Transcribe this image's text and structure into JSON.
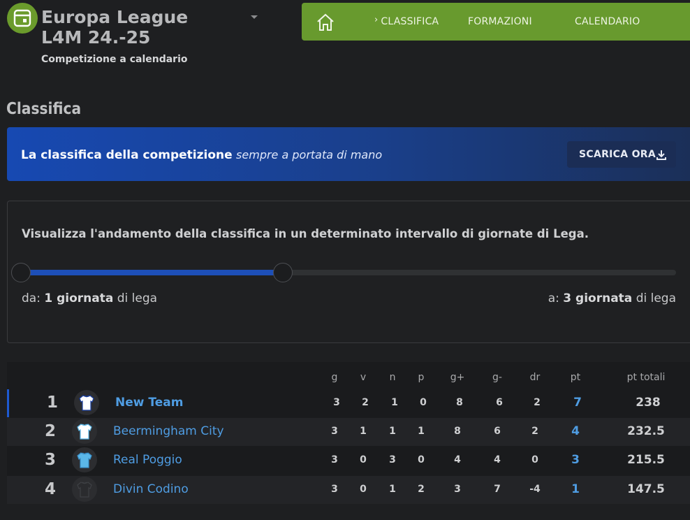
{
  "league": {
    "title": "Europa League L4M 24.-25",
    "subtitle": "Competizione a calendario",
    "logo_icon": "calendar-icon"
  },
  "nav": {
    "home_icon": "home-icon",
    "items": [
      {
        "label": "CLASSIFICA",
        "active": true
      },
      {
        "label": "FORMAZIONI",
        "active": false
      },
      {
        "label": "CALENDARIO",
        "active": false
      }
    ],
    "active_chevron": "›"
  },
  "page": {
    "title": "Classifica"
  },
  "promo": {
    "text_strong": "La classifica della competizione",
    "text_em": "sempre a portata di mano",
    "button_label": "SCARICA ORA",
    "button_icon": "download-icon"
  },
  "range": {
    "description": "Visualizza l'andamento della classifica in un determinato intervallo di giornate di Lega.",
    "from_prefix": "da:",
    "from_value": "1 giornata",
    "from_suffix": "di lega",
    "to_prefix": "a:",
    "to_value": "3 giornata",
    "to_suffix": "di lega",
    "slider_start_fraction": 0.0,
    "slider_end_fraction": 0.4
  },
  "standings": {
    "columns": [
      "g",
      "v",
      "n",
      "p",
      "g+",
      "g-",
      "dr",
      "pt",
      "pt totali"
    ],
    "rows": [
      {
        "rank": "1",
        "team": "New Team",
        "g": "3",
        "v": "2",
        "n": "1",
        "p": "0",
        "gf": "8",
        "ga": "6",
        "dr": "2",
        "pt": "7",
        "pt_totali": "238",
        "shirt_body": "#ffffff",
        "shirt_accent": "#1a3fa0"
      },
      {
        "rank": "2",
        "team": "Beermingham City",
        "g": "3",
        "v": "1",
        "n": "1",
        "p": "1",
        "gf": "8",
        "ga": "6",
        "dr": "2",
        "pt": "4",
        "pt_totali": "232.5",
        "shirt_body": "#ffffff",
        "shirt_accent": "#5bb7e8"
      },
      {
        "rank": "3",
        "team": "Real Poggio",
        "g": "3",
        "v": "0",
        "n": "3",
        "p": "0",
        "gf": "4",
        "ga": "4",
        "dr": "0",
        "pt": "3",
        "pt_totali": "215.5",
        "shirt_body": "#5bb7e8",
        "shirt_accent": "#3a8fc8"
      },
      {
        "rank": "4",
        "team": "Divin Codino",
        "g": "3",
        "v": "0",
        "n": "1",
        "p": "2",
        "gf": "3",
        "ga": "7",
        "dr": "-4",
        "pt": "1",
        "pt_totali": "147.5",
        "shirt_body": "#2a2b2e",
        "shirt_accent": "#3e4044"
      }
    ]
  }
}
